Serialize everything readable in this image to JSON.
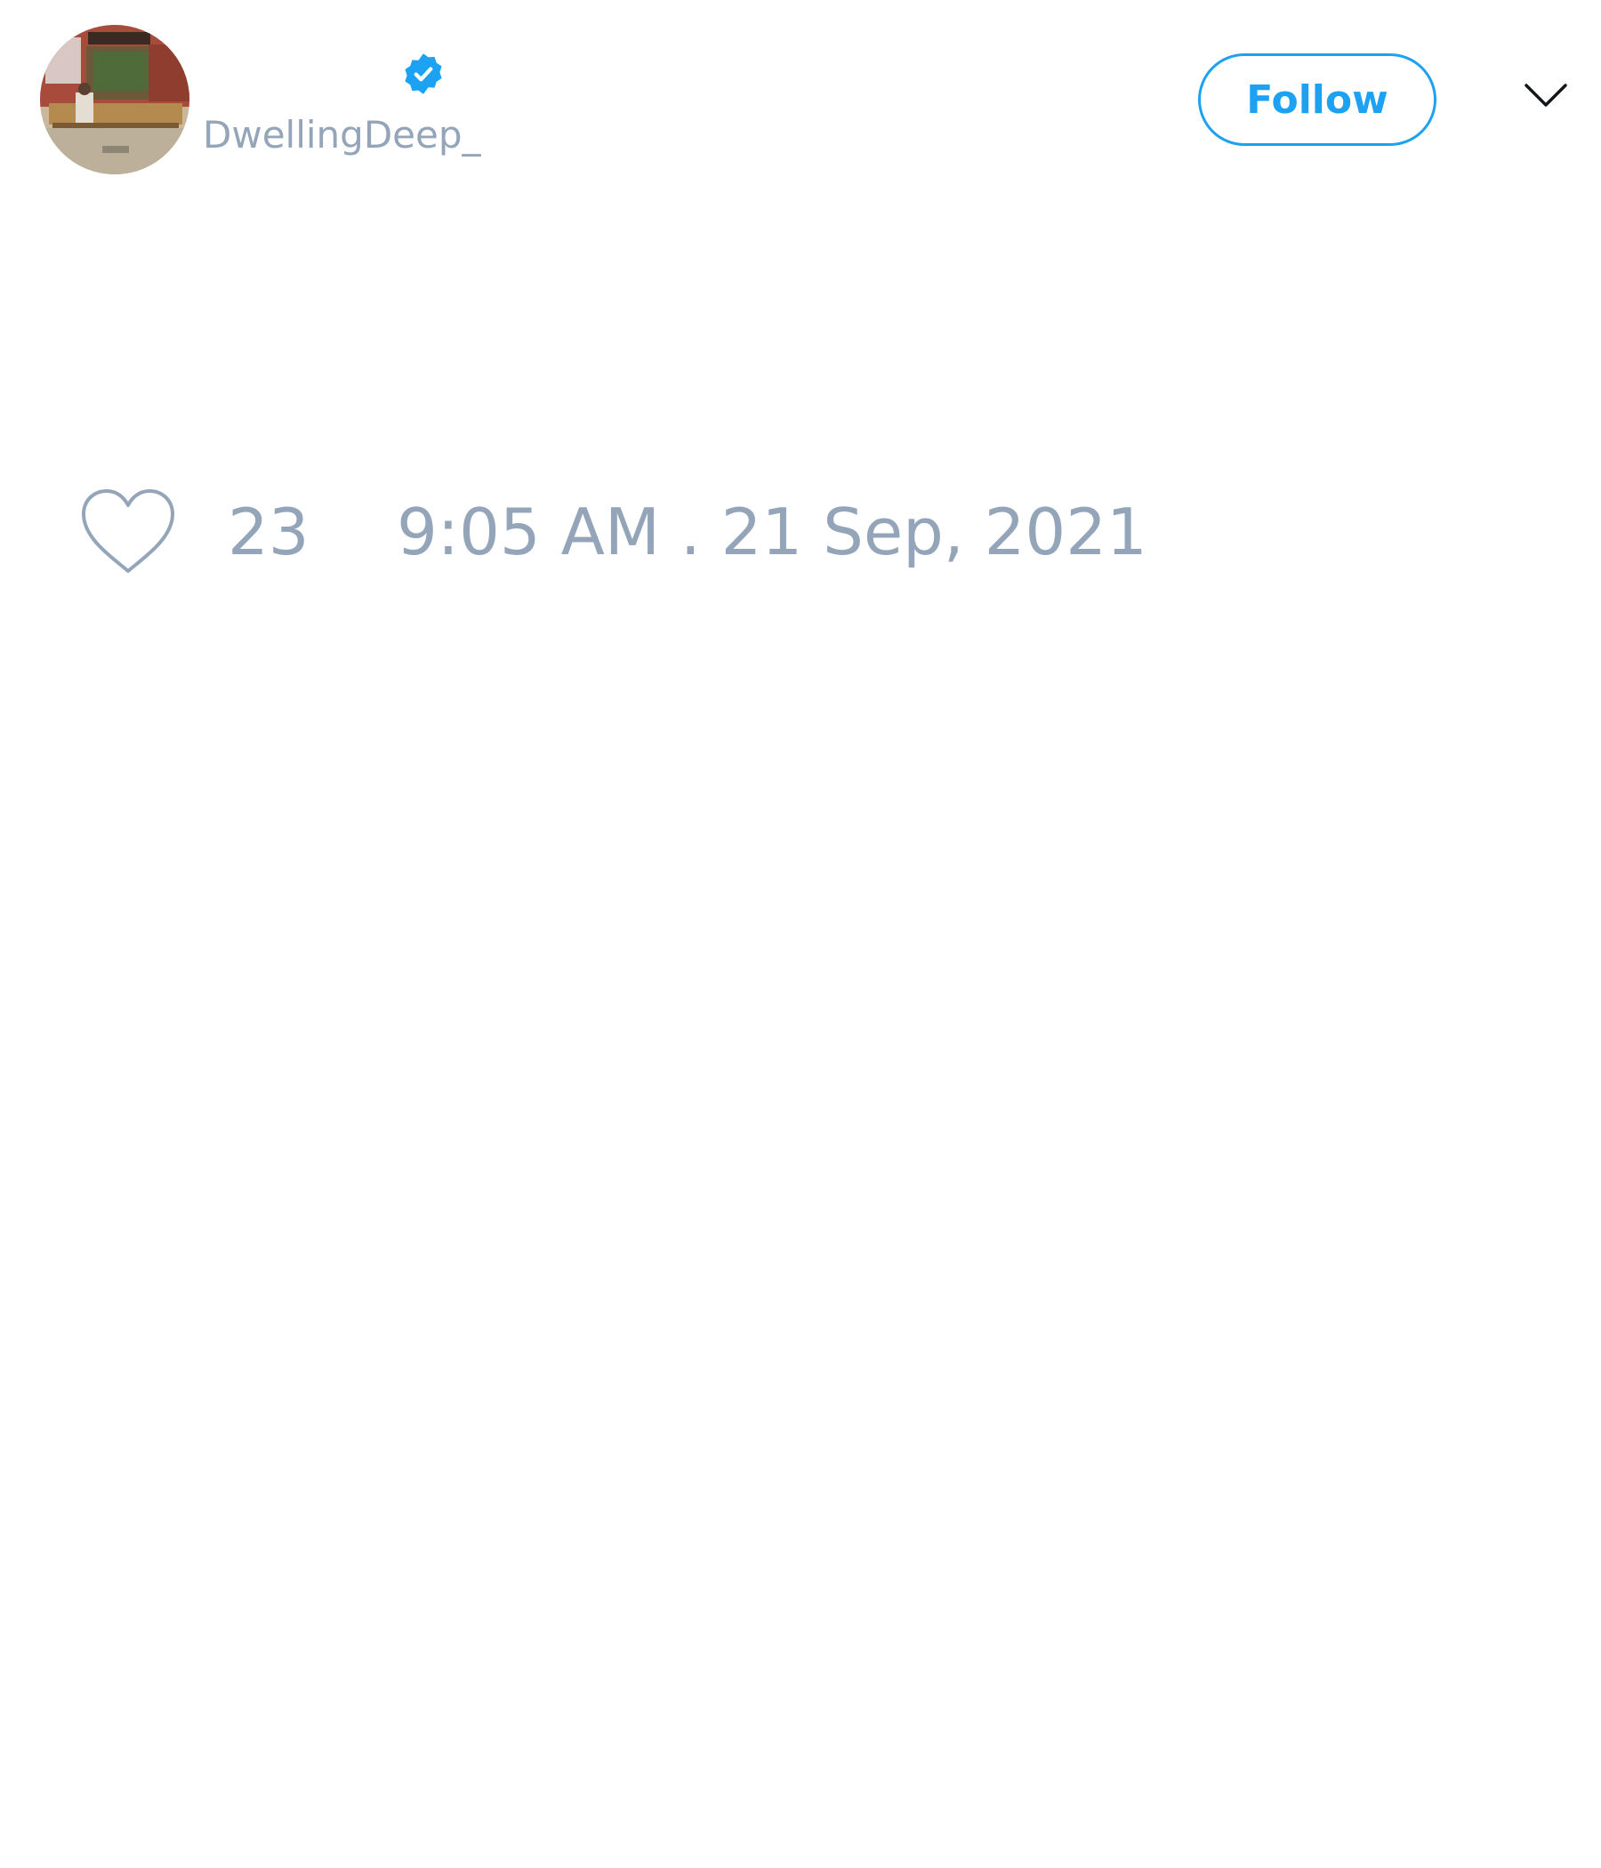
{
  "author": {
    "avatar_icon": "profile-photo",
    "verified_icon": "verified-badge-icon",
    "handle": "DwellingDeep_"
  },
  "actions": {
    "follow_label": "Follow",
    "menu_icon": "chevron-down-icon"
  },
  "engagement": {
    "like_icon": "heart-icon",
    "like_count": "23"
  },
  "meta": {
    "timestamp": "9:05 AM . 21 Sep, 2021"
  },
  "colors": {
    "accent": "#1da1f2",
    "muted_text": "#95a5b9",
    "background": "#ffffff"
  }
}
